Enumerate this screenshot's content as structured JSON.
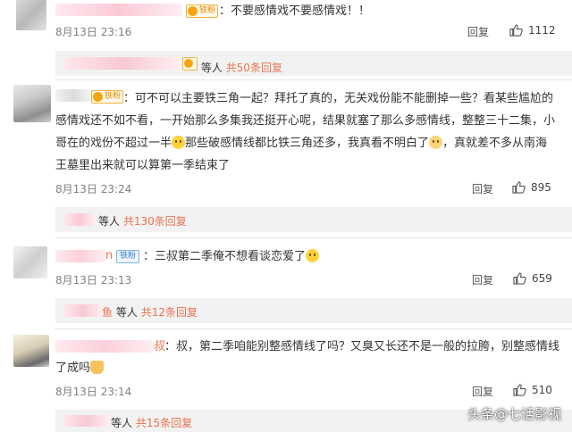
{
  "comments": [
    {
      "badge": "铁粉",
      "text": "：不要感情戏不要感情戏！！",
      "date": "8月13日 23:16",
      "reply_label": "回复",
      "likes": "1112",
      "replies": {
        "who": "等人",
        "count": "共50条回复"
      }
    },
    {
      "badge": "铁粉",
      "line1": "：可不可以主要铁三角一起？拜托了真的，无关戏份能不能删掉一些？看某些尴尬的",
      "line2": "感情戏还不如不看，一开始那么多集我还挺开心呢，结果就塞了那么多感情线，整整三十二集，小",
      "line3a": "哥在的戏份不超过一半",
      "line3b": "那些破感情线都比铁三角还多，我真看不明白了",
      "line3c": "，真就差不多从南海",
      "line4": "王墓里出来就可以算第一季结束了",
      "date": "8月13日 23:24",
      "reply_label": "回复",
      "likes": "895",
      "replies": {
        "who": "等人",
        "count": "共130条回复"
      }
    },
    {
      "name_tail": "n",
      "badge": "铁粉",
      "text": "：三叔第二季俺不想看谈恋爱了",
      "date": "8月13日 23:13",
      "reply_label": "回复",
      "likes": "659",
      "replies": {
        "name_tail": "鱼",
        "who": "等人",
        "count": "共12条回复"
      }
    },
    {
      "name_tail": "叔",
      "line1": "：叔，第二季咱能别整感情线了吗？又臭又长还不是一般的拉胯，别整感情线",
      "line2": "了成吗",
      "date": "8月13日 23:14",
      "reply_label": "回复",
      "likes": "510",
      "replies": {
        "who": "等人",
        "count": "共15条回复"
      }
    }
  ],
  "watermark": "头条@七话影视"
}
